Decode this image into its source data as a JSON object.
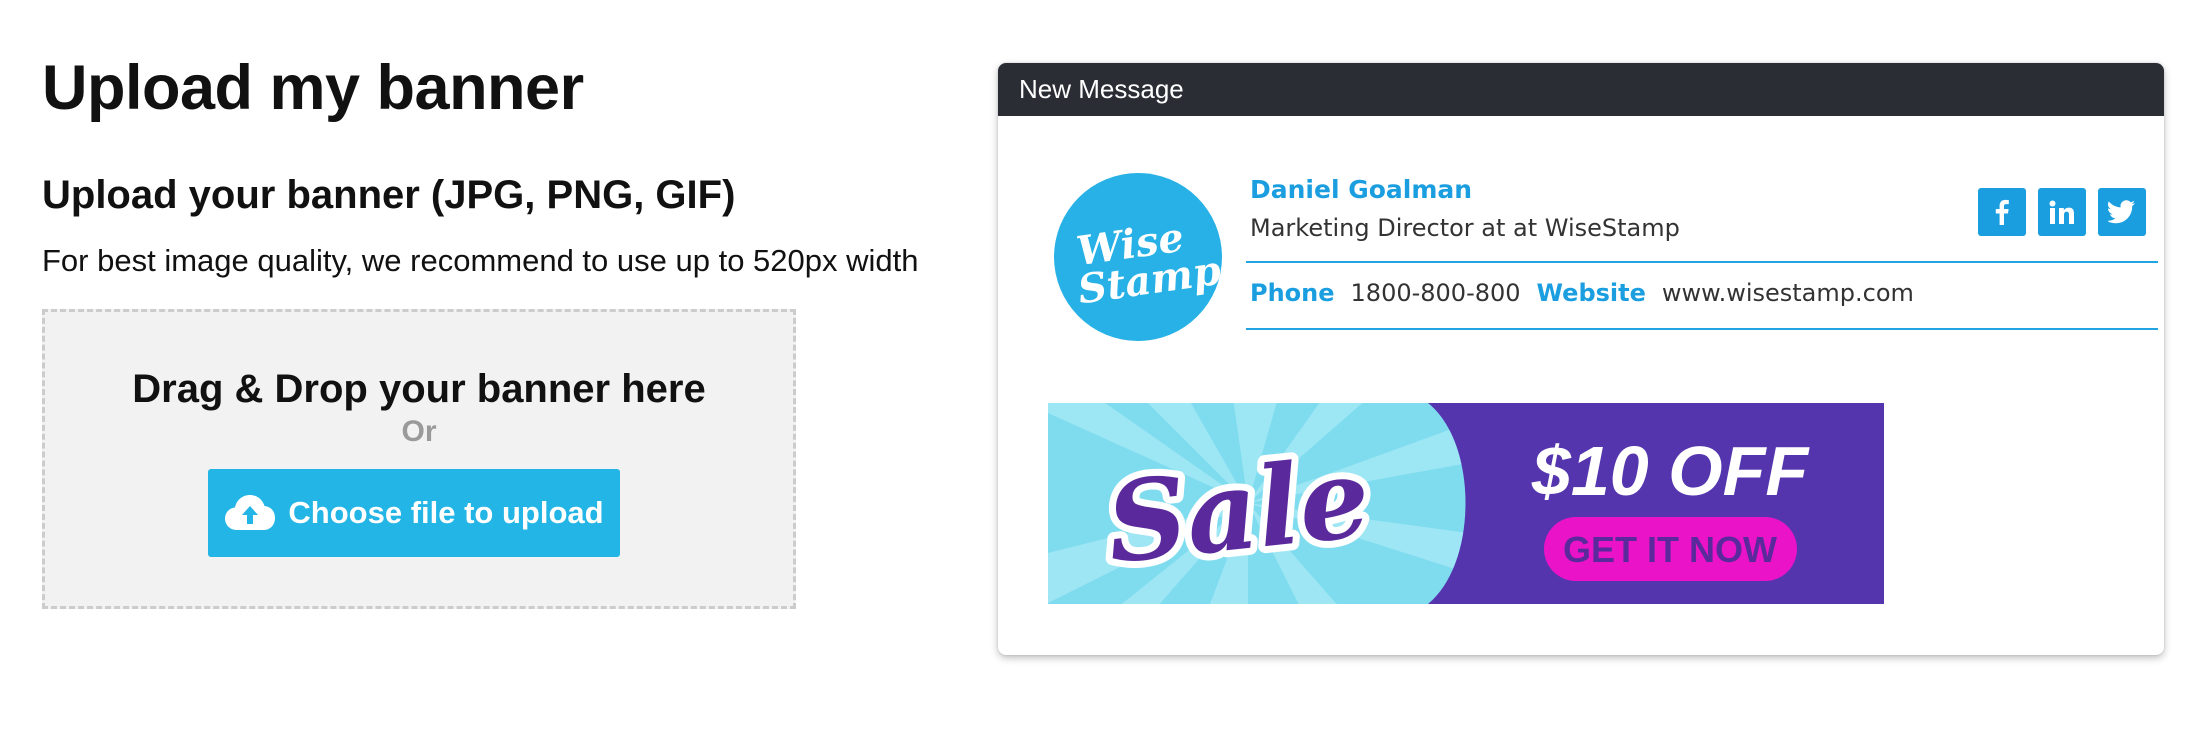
{
  "upload": {
    "page_title": "Upload my banner",
    "section_title": "Upload your banner (JPG, PNG, GIF)",
    "hint": "For best image quality, we recommend to use up to 520px width",
    "dropzone": {
      "title": "Drag & Drop your banner here",
      "or_text": "Or",
      "button_label": "Choose file to upload",
      "button_icon": "cloud-upload-icon"
    }
  },
  "preview": {
    "header_title": "New Message",
    "signature": {
      "avatar_logo_text": "WiseStamp",
      "name": "Daniel Goalman",
      "title": "Marketing Director at at WiseStamp",
      "phone_label": "Phone",
      "phone": "1800-800-800",
      "website_label": "Website",
      "website": "www.wisestamp.com",
      "social": [
        "facebook-icon",
        "linkedin-icon",
        "twitter-icon"
      ],
      "accent_color": "#1a9ee0"
    },
    "banner": {
      "left_text": "Sale",
      "headline": "$10 OFF",
      "cta": "GET IT NOW",
      "colors": {
        "left_bg": "#7fdcef",
        "right_bg": "#5535ae",
        "cta_bg": "#ea13c8",
        "sale_text": "#5a2a9c"
      }
    }
  },
  "colors": {
    "primary_button": "#22b5e6",
    "header_bg": "#2a2d34",
    "dropzone_bg": "#f2f2f2"
  }
}
